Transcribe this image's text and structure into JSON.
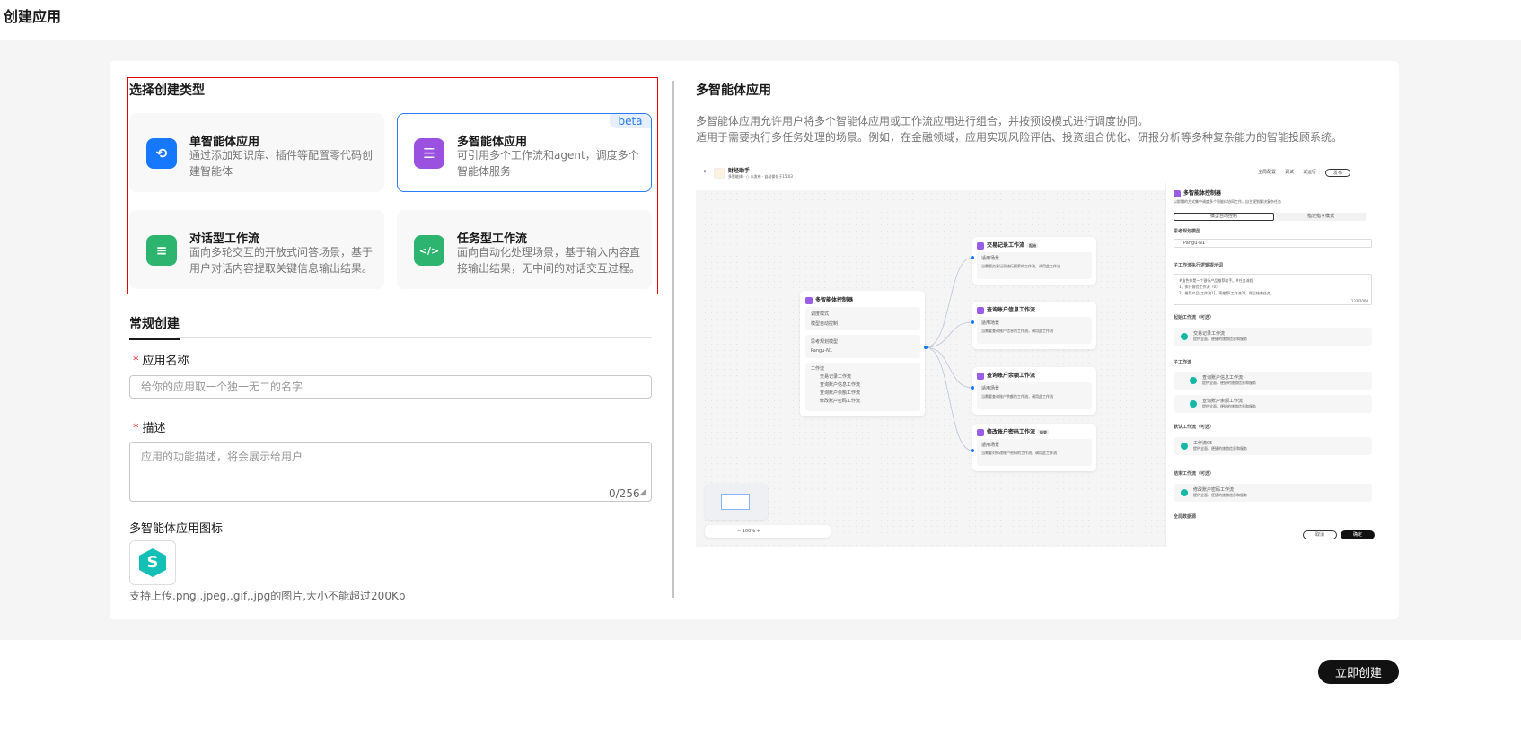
{
  "header": {
    "title": "创建应用"
  },
  "type_section": {
    "title": "选择创建类型",
    "cards": [
      {
        "title": "单智能体应用",
        "desc": "通过添加知识库、插件等配置零代码创建智能体",
        "icon": "agent-icon",
        "color": "#1677ff",
        "selected": false
      },
      {
        "title": "多智能体应用",
        "desc": "可引用多个工作流和agent，调度多个智能体服务",
        "icon": "multi-agent-icon",
        "color": "#9b51e0",
        "selected": true,
        "badge": "beta"
      },
      {
        "title": "对话型工作流",
        "desc": "面向多轮交互的开放式问答场景，基于用户对话内容提取关键信息输出结果。",
        "icon": "chat-icon",
        "color": "#2db46e",
        "selected": false
      },
      {
        "title": "任务型工作流",
        "desc": "面向自动化处理场景，基于输入内容直接输出结果，无中间的对话交互过程。",
        "icon": "code-icon",
        "color": "#2db46e",
        "selected": false
      }
    ]
  },
  "form": {
    "tab": "常规创建",
    "required_mark": "*",
    "name": {
      "label": "应用名称",
      "placeholder": "给你的应用取一个独一无二的名字",
      "value": ""
    },
    "desc": {
      "label": "描述",
      "placeholder": "应用的功能描述，将会展示给用户",
      "value": "",
      "counter": "0/256"
    },
    "icon": {
      "label": "多智能体应用图标",
      "hint": "支持上传.png,.jpeg,.gif,.jpg的图片,大小不能超过200Kb"
    }
  },
  "info": {
    "title": "多智能体应用",
    "lines": [
      "多智能体应用允许用户将多个智能体应用或工作流应用进行组合，并按预设模式进行调度协同。",
      "适用于需要执行多任务处理的场景。例如，在金融领域，应用实现风险评估、投资组合优化、研报分析等多种复杂能力的智能投顾系统。"
    ]
  },
  "preview": {
    "app_name": "财经助手",
    "meta": "多智能体 · ○ 未发布 · 自动保存于15:03",
    "top_actions": [
      "全局配置",
      "调试",
      "试运行",
      "发布"
    ],
    "controller": {
      "title": "多智能体控制器",
      "fields": [
        {
          "label": "调度模式",
          "value": "模型自动控制"
        },
        {
          "label": "思考规划模型",
          "value": "Pangu-N1"
        }
      ],
      "workflow_label": "工作流",
      "workflows": [
        "交易记录工作流",
        "查询账户信息工作流",
        "查询账户余额工作流",
        "修改账户密码工作流"
      ]
    },
    "nodes": [
      {
        "title": "交易记录工作流",
        "tag": "起始",
        "label": "适用场景",
        "desc": "当需要交易记录进行搜索的工作流，调用此工作流"
      },
      {
        "title": "查询账户信息工作流",
        "label": "适用场景",
        "desc": "当需要查询账户信息的工作流，调用此工作流"
      },
      {
        "title": "查询账户余额工作流",
        "label": "适用场景",
        "desc": "当需要查询账户余额的工作流，调用此工作流"
      },
      {
        "title": "修改账户密码工作流",
        "tag": "结束",
        "label": "适用场景",
        "desc": "当需要对修改账户密码的工作流，调用此工作流"
      }
    ],
    "zoom": "100%",
    "panel": {
      "title": "多智能体控制器",
      "desc": "以群體的方式集中调度多个智能体协同工作，自主规划解决复杂任务",
      "modes": [
        "模型自动控制",
        "指定指令模式"
      ],
      "model_label": "思考规划模型",
      "model": "Pangu-N1",
      "prompt_label": "子工作流执行逻辑提示词",
      "prompt": [
        "#角色你是一个银行产品推荐助手。#任务流程",
        "1、执行前验工作流（0）",
        "2、推荐产品[工作流1]，再推荐[工作流2]，然后结束任务。..."
      ],
      "prompt_count": "132/2000",
      "sections": [
        {
          "label": "起始工作流（可选）",
          "items": [
            {
              "name": "交易记录工作流",
              "desc": "提供全面、便捷的旅游信息和服务"
            }
          ]
        },
        {
          "label": "子工作流",
          "items": [
            {
              "name": "查询账户信息工作流",
              "desc": "提供全面、便捷的旅游信息和服务"
            },
            {
              "name": "查询账户余额工作流",
              "desc": "提供全面、便捷的旅游信息和服务"
            }
          ]
        },
        {
          "label": "默认工作流（可选）",
          "items": [
            {
              "name": "工作流05",
              "desc": "提供全面、便捷的旅游信息和服务"
            }
          ]
        },
        {
          "label": "结束工作流（可选）",
          "items": [
            {
              "name": "修改账户密码工作流",
              "desc": "提供全面、便捷的旅游信息和服务"
            }
          ]
        }
      ],
      "global_label": "全局数据源",
      "cancel": "取消",
      "confirm": "确定"
    }
  },
  "footer": {
    "create_label": "立即创建"
  }
}
